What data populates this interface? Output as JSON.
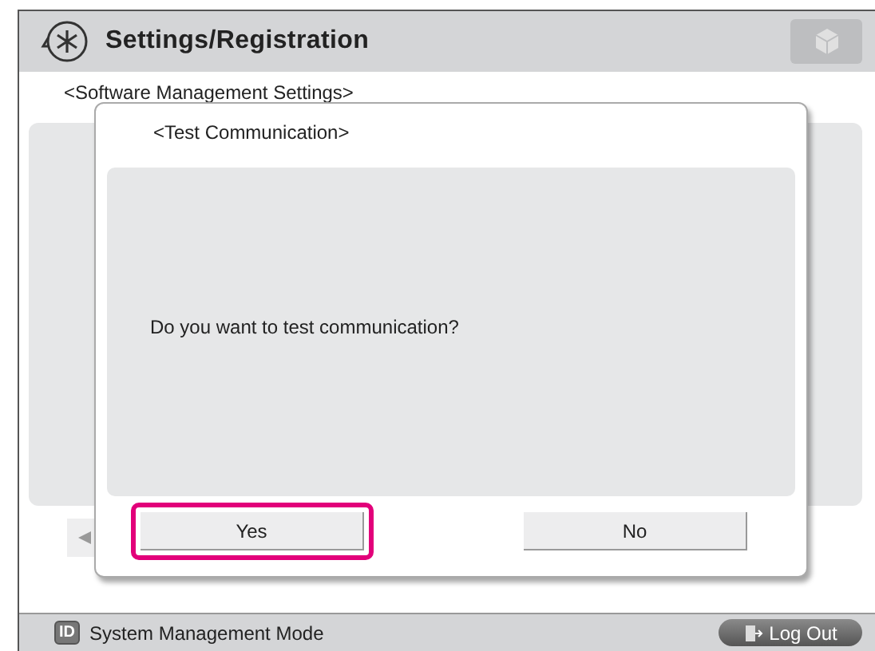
{
  "header": {
    "title": "Settings/Registration"
  },
  "page": {
    "subtitle": "<Software Management Settings>"
  },
  "dialog": {
    "title": "<Test Communication>",
    "message": "Do you want to test communication?",
    "buttons": [
      {
        "label": "Yes",
        "highlighted": true
      },
      {
        "label": "No",
        "highlighted": false
      }
    ]
  },
  "status_bar": {
    "mode": "System Management Mode",
    "id_badge": "ID",
    "logout": "Log Out"
  }
}
